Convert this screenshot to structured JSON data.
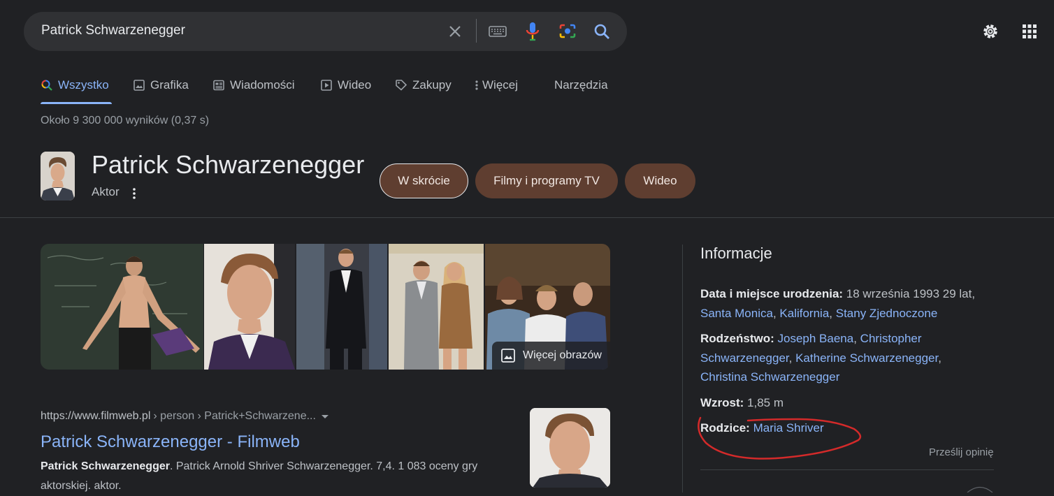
{
  "search": {
    "query": "Patrick Schwarzenegger",
    "icons": [
      "close-icon",
      "keyboard-icon",
      "mic-icon",
      "camera-lens-icon",
      "search-icon"
    ]
  },
  "top_right": {
    "icons": [
      "gear-icon",
      "apps-grid-icon"
    ]
  },
  "tabs": [
    {
      "label": "Wszystko",
      "icon": "search-icon",
      "active": true
    },
    {
      "label": "Grafika",
      "icon": "image-icon"
    },
    {
      "label": "Wiadomości",
      "icon": "news-icon"
    },
    {
      "label": "Wideo",
      "icon": "play-icon"
    },
    {
      "label": "Zakupy",
      "icon": "tag-icon"
    },
    {
      "label": "Więcej",
      "icon": "more-vert-icon"
    },
    {
      "label": "Narzędzia"
    }
  ],
  "result_stats": "Około 9 300 000 wyników (0,37 s)",
  "entity": {
    "name": "Patrick Schwarzenegger",
    "type": "Aktor",
    "chips": [
      "W skrócie",
      "Filmy i programy TV",
      "Wideo"
    ]
  },
  "images": {
    "more_label": "Więcej obrazów"
  },
  "result": {
    "url_domain": "https://www.filmweb.pl",
    "url_path": " › person › Patrick+Schwarzene...",
    "title": "Patrick Schwarzenegger - Filmweb",
    "snippet_bold": "Patrick Schwarzenegger",
    "snippet_rest": ". Patrick Arnold Shriver Schwarzenegger. 7,4. 1 083 oceny gry aktorskiej. aktor."
  },
  "knowledge_panel": {
    "title": "Informacje",
    "birth_label": "Data i miejsce urodzenia:",
    "birth_date": " 18 września 1993 29 lat,",
    "birth_place_1": "Santa Monica",
    "birth_place_2": "Kalifornia",
    "birth_place_3": "Stany Zjednoczone",
    "siblings_label": "Rodzeństwo:",
    "siblings": [
      "Joseph Baena",
      "Christopher Schwarzenegger",
      "Katherine Schwarzenegger",
      "Christina Schwarzenegger"
    ],
    "height_label": "Wzrost:",
    "height": " 1,85 m",
    "parents_label": "Rodzice:",
    "parents": "Maria Shriver",
    "feedback": "Prześlij opinię"
  },
  "colors": {
    "background": "#202124",
    "link": "#8ab4f8",
    "chip": "#5f3e30",
    "annotation": "#d42a2a"
  }
}
